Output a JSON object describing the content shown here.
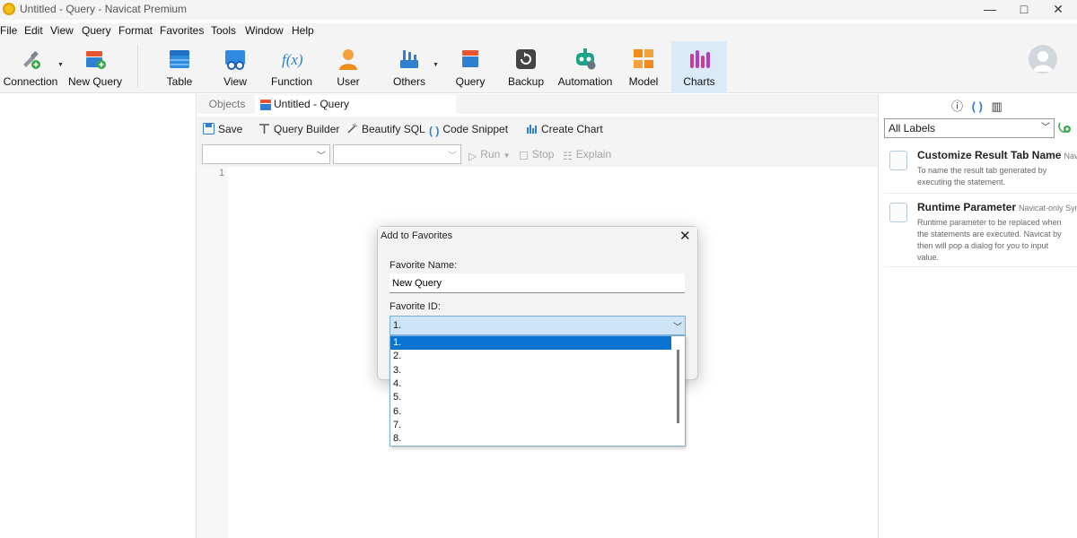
{
  "window": {
    "title": "Untitled - Query - Navicat Premium",
    "controls": [
      "—",
      "□",
      "✕"
    ]
  },
  "menu": [
    "File",
    "Edit",
    "View",
    "Query",
    "Format",
    "Favorites",
    "Tools",
    "Window",
    "Help"
  ],
  "toolbar": {
    "connection": "Connection",
    "new_query": "New Query",
    "table": "Table",
    "view": "View",
    "function": "Function",
    "user": "User",
    "others": "Others",
    "query": "Query",
    "backup": "Backup",
    "automation": "Automation",
    "model": "Model",
    "charts": "Charts"
  },
  "tabs": {
    "objects": "Objects",
    "query_tab": "Untitled - Query"
  },
  "query_toolbar": {
    "save": "Save",
    "query_builder": "Query Builder",
    "beautify": "Beautify SQL",
    "code_snippet": "Code Snippet",
    "create_chart": "Create Chart",
    "run": "Run",
    "stop": "Stop",
    "explain": "Explain"
  },
  "editor": {
    "line_number": "1"
  },
  "right_panel": {
    "labels_value": "All Labels",
    "snippets": [
      {
        "title": "Customize Result Tab Name",
        "tag": "Navi",
        "desc": "To name the result tab generated by executing the statement."
      },
      {
        "title": "Runtime Parameter",
        "tag": "Navicat-only Sym",
        "desc": "Runtime parameter to be replaced when the statements are executed. Navicat by then will pop a dialog for you to input value."
      }
    ]
  },
  "dialog": {
    "title": "Add to Favorites",
    "name_label": "Favorite Name:",
    "name_value": "New Query",
    "id_label": "Favorite ID:",
    "id_value": "1.",
    "options": [
      "1.",
      "2.",
      "3.",
      "4.",
      "5.",
      "6.",
      "7.",
      "8."
    ],
    "selected_index": 0
  },
  "colors": {
    "accent": "#0a73d2",
    "charts_active_bg": "#dbeaf7",
    "select_bg": "#cde5f7"
  }
}
